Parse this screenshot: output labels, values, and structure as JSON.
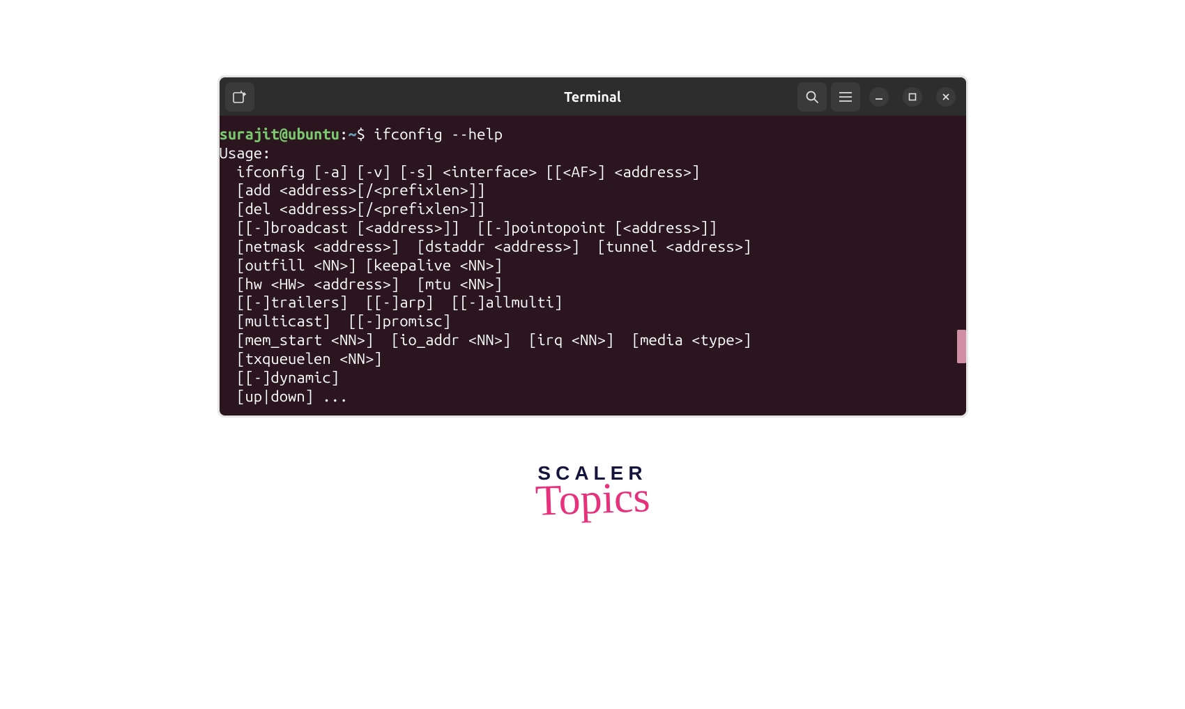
{
  "titlebar": {
    "title": "Terminal"
  },
  "prompt": {
    "userhost": "surajit@ubuntu",
    "colon": ":",
    "path": "~",
    "dollar": "$ ",
    "command": "ifconfig --help"
  },
  "output": {
    "l0": "Usage:",
    "l1": "  ifconfig [-a] [-v] [-s] <interface> [[<AF>] <address>]",
    "l2": "  [add <address>[/<prefixlen>]]",
    "l3": "  [del <address>[/<prefixlen>]]",
    "l4": "  [[-]broadcast [<address>]]  [[-]pointopoint [<address>]]",
    "l5": "  [netmask <address>]  [dstaddr <address>]  [tunnel <address>]",
    "l6": "  [outfill <NN>] [keepalive <NN>]",
    "l7": "  [hw <HW> <address>]  [mtu <NN>]",
    "l8": "  [[-]trailers]  [[-]arp]  [[-]allmulti]",
    "l9": "  [multicast]  [[-]promisc]",
    "l10": "  [mem_start <NN>]  [io_addr <NN>]  [irq <NN>]  [media <type>]",
    "l11": "  [txqueuelen <NN>]",
    "l12": "  [[-]dynamic]",
    "l13": "  [up|down] ..."
  },
  "brand": {
    "line1": "SCALER",
    "line2": "Topics"
  }
}
